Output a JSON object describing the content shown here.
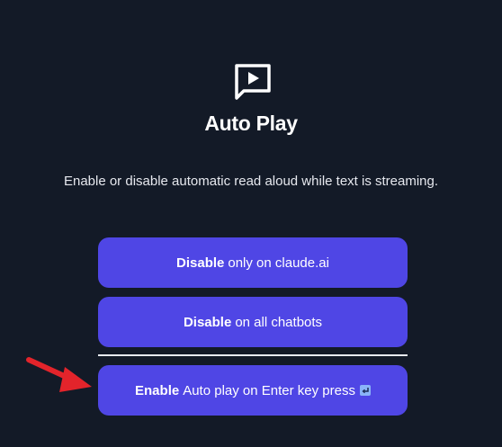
{
  "header": {
    "icon": "play-message-icon",
    "title": "Auto Play",
    "description": "Enable or disable automatic read aloud while text is streaming."
  },
  "buttons": [
    {
      "bold": "Disable",
      "rest": "only on claude.ai"
    },
    {
      "bold": "Disable",
      "rest": "on all chatbots"
    },
    {
      "bold": "Enable",
      "rest": "Auto play on Enter key press",
      "icon": "enter-key-icon"
    }
  ],
  "colors": {
    "background": "#131a27",
    "button": "#4f46e5",
    "arrow": "#e3242b"
  }
}
